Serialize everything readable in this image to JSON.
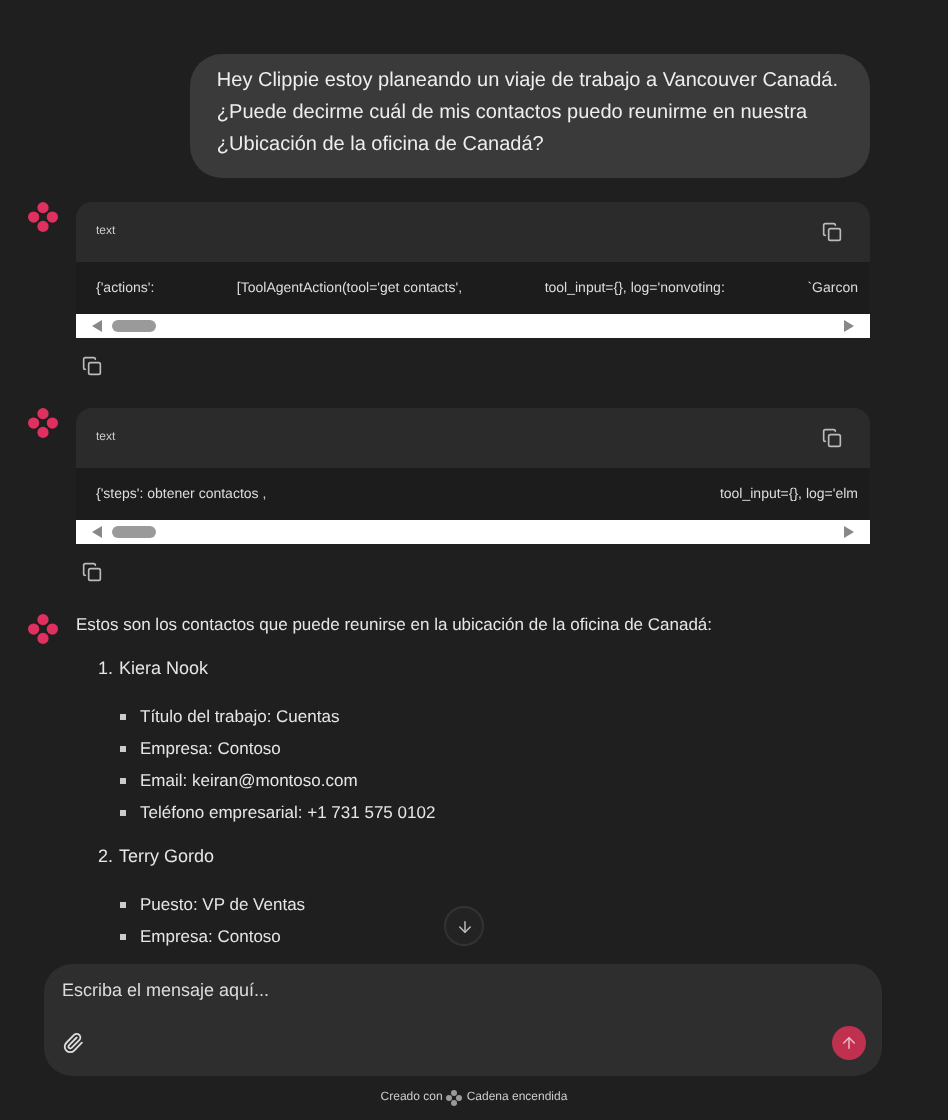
{
  "user_message": {
    "lines": [
      "Hey Clippie estoy planeando un viaje de trabajo a Vancouver Canadá.",
      "¿Puede decirme cuál de mis contactos puedo reunirme en nuestra",
      "¿Ubicación de la oficina de Canadá?"
    ]
  },
  "code_blocks": [
    {
      "language": "text",
      "segments": [
        "{'actions':",
        "[ToolAgentAction(tool='get contacts',",
        "tool_input={}, log='nonvoting:",
        "`Garcon"
      ]
    },
    {
      "language": "text",
      "segments": [
        "{'steps': obtener contactos ,",
        "tool_input={}, log='elm"
      ]
    }
  ],
  "answer": {
    "intro": "Estos son los contactos que puede reunirse en la ubicación de la oficina de Canadá:",
    "contacts": [
      {
        "number": "1.",
        "name": "Kiera Nook",
        "details": [
          "Título del trabajo: Cuentas",
          "Empresa: Contoso",
          "Email: keiran@montoso.com",
          "Teléfono empresarial: +1 731 575 0102"
        ]
      },
      {
        "number": "2.",
        "name": "Terry Gordo",
        "details": [
          "Puesto: VP de Ventas",
          "Empresa: Contoso"
        ]
      }
    ]
  },
  "composer": {
    "placeholder": "Escriba el mensaje aquí..."
  },
  "footer": {
    "prefix": "Creado con",
    "suffix": "Cadena encendida"
  }
}
